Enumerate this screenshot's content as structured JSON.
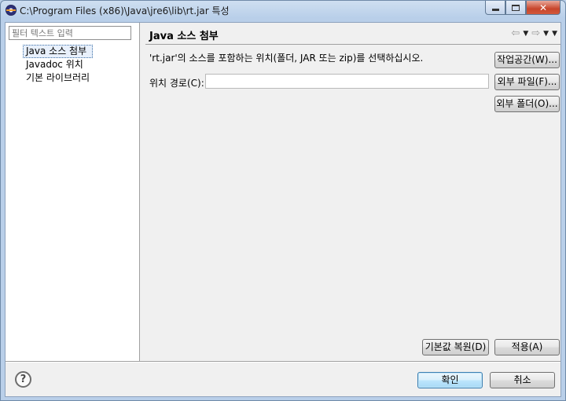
{
  "window": {
    "title": "C:\\Program Files (x86)\\Java\\jre6\\lib\\rt.jar 특성",
    "app_icon": "eclipse-icon",
    "caption_buttons": [
      "minimize-icon",
      "maximize-icon",
      "close-icon"
    ],
    "close_glyph": "✕"
  },
  "sidebar": {
    "filter_placeholder": "필터 텍스트 입력",
    "items": [
      {
        "label": "Java 소스 첨부",
        "selected": true
      },
      {
        "label": "Javadoc 위치",
        "selected": false
      },
      {
        "label": "기본 라이브러리",
        "selected": false
      }
    ]
  },
  "page": {
    "title": "Java 소스 첨부",
    "nav_icons": [
      "back-arrow-icon",
      "chevron-down-icon",
      "forward-arrow-icon",
      "chevron-down-icon",
      "menu-down-icon"
    ],
    "back_glyph": "⇦",
    "forward_glyph": "⇨",
    "dropdown_glyph": "▼",
    "description": "'rt.jar'의 소스를 포함하는 위치(폴더, JAR 또는 zip)를 선택하십시오.",
    "path_label": "위치 경로(C):",
    "path_value": "",
    "workspace_button": "작업공간(W)...",
    "external_file_button": "외부 파일(F)...",
    "external_folder_button": "외부 폴더(O)...",
    "restore_defaults_button": "기본값 복원(D)",
    "apply_button": "적용(A)"
  },
  "footer": {
    "help_glyph": "?",
    "ok_button": "확인",
    "cancel_button": "취소"
  },
  "colors": {
    "title_gradient_top": "#cfdff1",
    "client_bg": "#f0f0f0",
    "default_button_border": "#3c7fb1",
    "close_button": "#c7452b"
  }
}
